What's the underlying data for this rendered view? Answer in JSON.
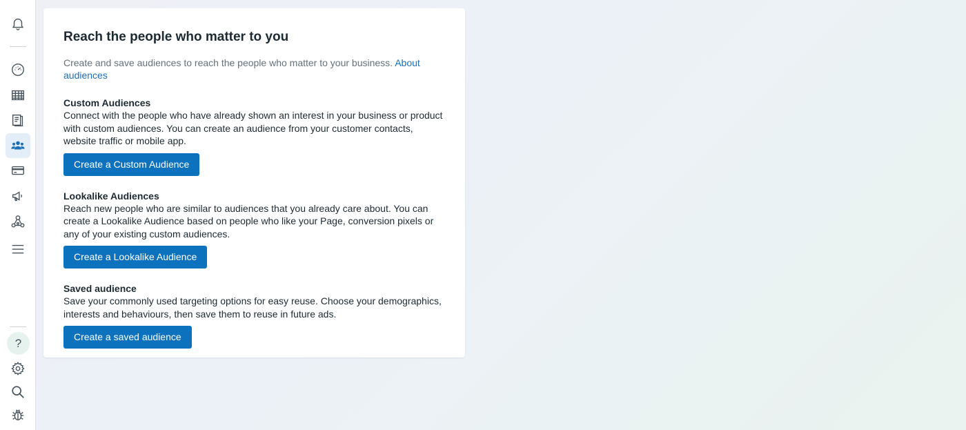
{
  "sidebar": {
    "top_icons": [
      {
        "name": "notifications-icon"
      },
      {
        "name": "dashboard-icon"
      },
      {
        "name": "table-icon"
      },
      {
        "name": "catalog-icon"
      },
      {
        "name": "audiences-icon",
        "active": true
      },
      {
        "name": "billing-icon"
      },
      {
        "name": "ads-megaphone-icon"
      },
      {
        "name": "events-manager-icon"
      },
      {
        "name": "menu-icon"
      }
    ],
    "bottom_icons": [
      {
        "name": "help-icon",
        "glyph": "?"
      },
      {
        "name": "settings-icon"
      },
      {
        "name": "search-icon"
      },
      {
        "name": "bug-report-icon"
      }
    ]
  },
  "main": {
    "title": "Reach the people who matter to you",
    "subtitle": "Create and save audiences to reach the people who matter to your business.",
    "subtitle_link": "About audiences",
    "sections": [
      {
        "title": "Custom Audiences",
        "description": "Connect with the people who have already shown an interest in your business or product with custom audiences. You can create an audience from your customer contacts, website traffic or mobile app.",
        "button": "Create a Custom Audience"
      },
      {
        "title": "Lookalike Audiences",
        "description": "Reach new people who are similar to audiences that you already care about. You can create a Lookalike Audience based on people who like your Page, conversion pixels or any of your existing custom audiences.",
        "button": "Create a Lookalike Audience"
      },
      {
        "title": "Saved audience",
        "description": "Save your commonly used targeting options for easy reuse. Choose your demographics, interests and behaviours, then save them to reuse in future ads.",
        "button": "Create a saved audience"
      }
    ]
  },
  "colors": {
    "accent": "#0d72bd",
    "link": "#1d6fb8",
    "active_bg": "#e4eef8"
  }
}
